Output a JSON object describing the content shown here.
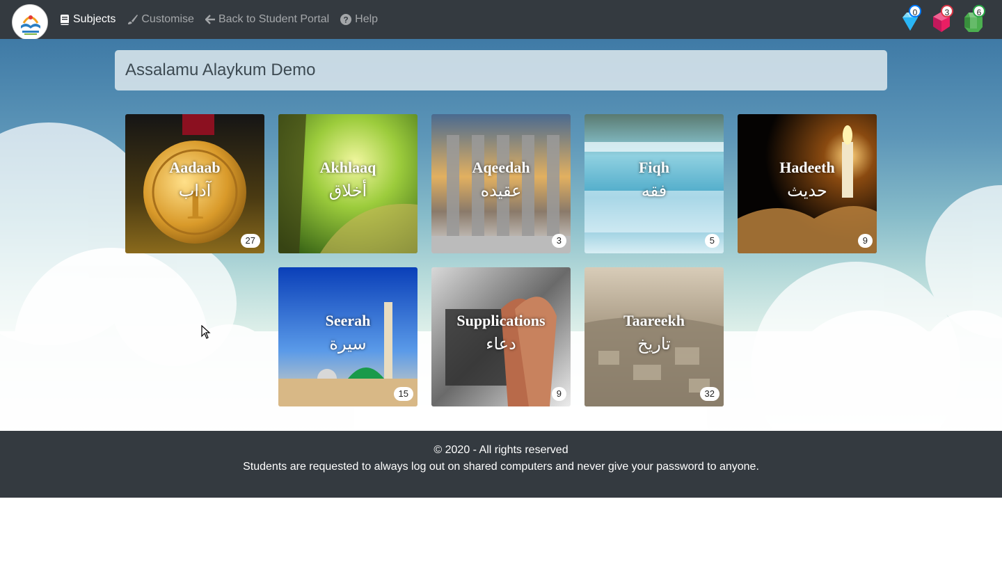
{
  "nav": {
    "items": [
      {
        "label": "Subjects",
        "icon": "book-icon",
        "active": true
      },
      {
        "label": "Customise",
        "icon": "paintbrush-icon",
        "active": false
      },
      {
        "label": "Back to Student Portal",
        "icon": "arrow-left-icon",
        "active": false
      },
      {
        "label": "Help",
        "icon": "question-circle-icon",
        "active": false
      }
    ],
    "gems": [
      {
        "icon": "diamond-gem-icon",
        "count": "0",
        "color": "#4fc3f7"
      },
      {
        "icon": "ruby-gem-icon",
        "count": "3",
        "color": "#e91e63"
      },
      {
        "icon": "emerald-gem-icon",
        "count": "6",
        "color": "#4caf50"
      }
    ]
  },
  "greeting": "Assalamu Alaykum Demo",
  "subjects": [
    {
      "name": "Aadaab",
      "arabic": "آداب",
      "count": "27"
    },
    {
      "name": "Akhlaaq",
      "arabic": "أخلاق",
      "count": ""
    },
    {
      "name": "Aqeedah",
      "arabic": "عقيده",
      "count": "3"
    },
    {
      "name": "Fiqh",
      "arabic": "فقه",
      "count": "5"
    },
    {
      "name": "Hadeeth",
      "arabic": "حديث",
      "count": "9"
    },
    {
      "name": "Seerah",
      "arabic": "سيرة",
      "count": "15"
    },
    {
      "name": "Supplications",
      "arabic": "دعاء",
      "count": "9"
    },
    {
      "name": "Taareekh",
      "arabic": "تاريخ",
      "count": "32"
    }
  ],
  "footer": {
    "copyright": "© 2020 - All rights reserved",
    "notice": "Students are requested to always log out on shared computers and never give your password to anyone."
  }
}
